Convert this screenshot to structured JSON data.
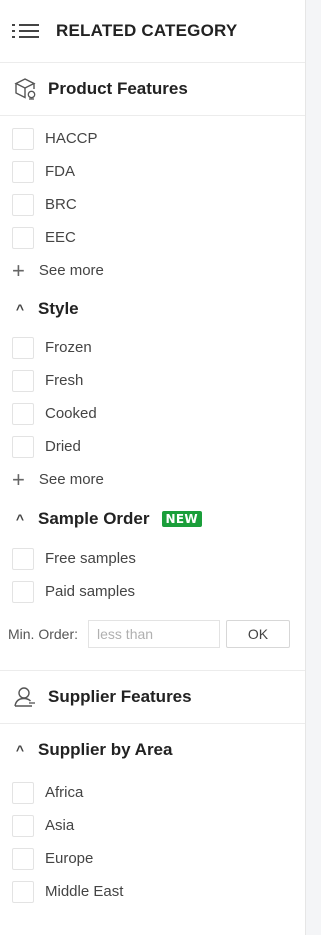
{
  "header": {
    "title": "RELATED CATEGORY",
    "icon": "list-icon"
  },
  "product_features": {
    "title": "Product Features",
    "icon": "box-icon",
    "items": [
      "HACCP",
      "FDA",
      "BRC",
      "EEC"
    ],
    "see_more": "See more"
  },
  "style": {
    "title": "Style",
    "items": [
      "Frozen",
      "Fresh",
      "Cooked",
      "Dried"
    ],
    "see_more": "See more"
  },
  "sample_order": {
    "title": "Sample Order",
    "badge": "NEW",
    "badge_color": "#1a9e3a",
    "items": [
      "Free samples",
      "Paid samples"
    ]
  },
  "min_order": {
    "label": "Min. Order:",
    "placeholder": "less than",
    "ok": "OK"
  },
  "supplier_features": {
    "title": "Supplier Features",
    "icon": "user-icon"
  },
  "supplier_area": {
    "title": "Supplier by Area",
    "items": [
      "Africa",
      "Asia",
      "Europe",
      "Middle East"
    ]
  }
}
